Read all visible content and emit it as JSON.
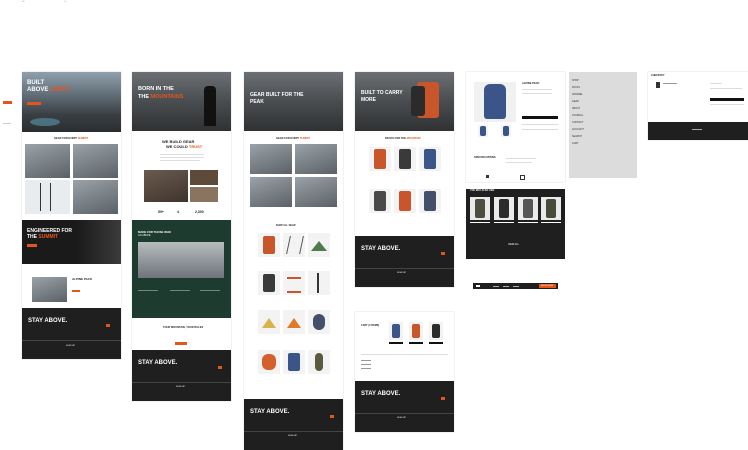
{
  "brand": {
    "accent": "#e2561b",
    "dark": "#1f1f1f",
    "forest": "#1e3b2f"
  },
  "canvas": {
    "corner_label_left": "•••",
    "corner_label_right": "• •"
  },
  "screens": {
    "home": {
      "hero_line1": "BUILT",
      "hero_line2": "ABOVE",
      "hero_accent": "LIMITS",
      "section_title_a": "GEAR FOR EVERY",
      "section_title_b": "SUMMIT",
      "banner_line1": "ENGINEERED FOR",
      "banner_line2": "THE",
      "banner_accent": "SUMMIT",
      "promo_title": "ALPINE PACK",
      "stay_above": "STAY ABOVE.",
      "footer_link": "SIGN UP"
    },
    "about": {
      "hero_line1": "BORN IN THE",
      "hero_line2": "THE",
      "hero_accent": "MOUNTAINS",
      "mission_line1": "WE BUILD GEAR",
      "mission_line2": "WE COULD",
      "mission_accent": "TRUST",
      "stat_1": "50+",
      "stat_2": "4",
      "stat_3": "2,300",
      "green_title": "MADE FOR THOSE WHO",
      "green_sub": "GO ABOVE",
      "quote": "YOUR MOUNTAIN, YOUR RULES",
      "stay_above": "STAY ABOVE.",
      "footer_link": "SIGN UP"
    },
    "shop": {
      "hero_line1": "GEAR BUILT FOR THE",
      "hero_accent": "PEAK",
      "section_title_a": "GEAR FOR EVERY",
      "section_title_b": "SUMMIT",
      "grid_title": "SHOP ALL GEAR",
      "stay_above": "STAY ABOVE.",
      "footer_link": "SIGN UP"
    },
    "packs": {
      "hero_line1": "BUILT TO CARRY",
      "hero_accent": "MORE",
      "section_title_a": "PACKS FOR THE",
      "section_title_b": "MOUNTAIN",
      "stay_above": "STAY ABOVE.",
      "footer_link": "SIGN UP"
    },
    "cart": {
      "title": "CART (3 ITEMS)",
      "stay_above": "STAY ABOVE.",
      "footer_link": "SIGN UP"
    },
    "product": {
      "heading": "ALPINE PACK",
      "specs_title": "SPECIFICATIONS",
      "related_title": "YOU MAY ALSO LIKE",
      "related_button": "VIEW ALL"
    },
    "menu": {
      "items": [
        "SHOP",
        "PACKS",
        "APPAREL",
        "GEAR",
        "ABOUT",
        "JOURNAL",
        "CONTACT",
        "ACCOUNT",
        "SEARCH",
        "CART"
      ]
    },
    "checkout": {
      "title": "CHECKOUT"
    },
    "navbar": {
      "cta": "SHOP NOW"
    }
  }
}
